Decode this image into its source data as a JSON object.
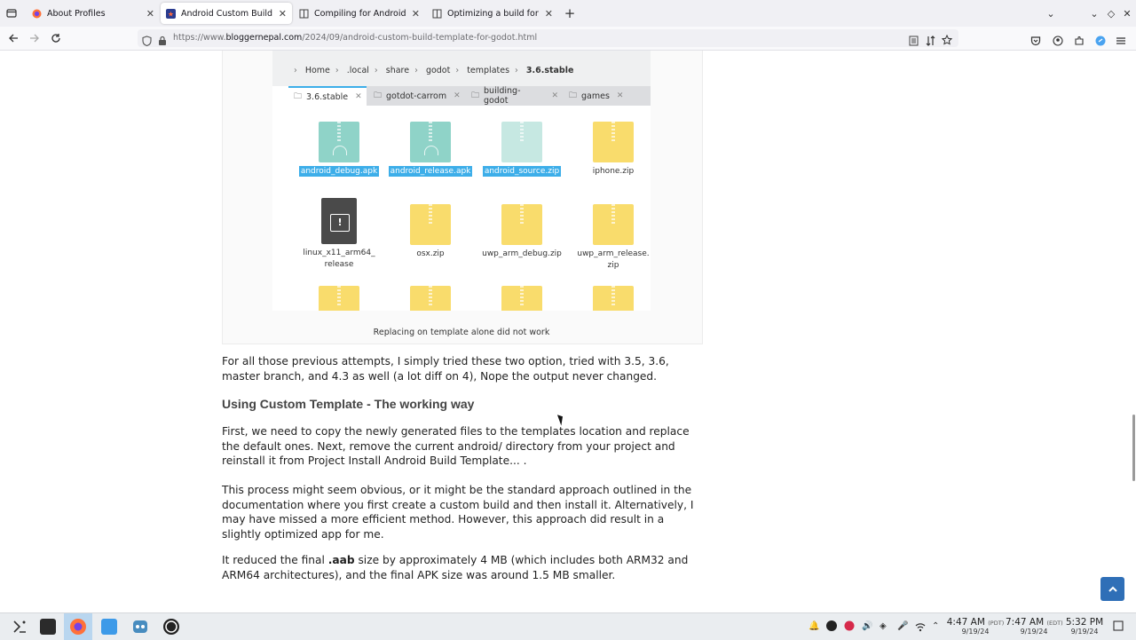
{
  "browser": {
    "tabs": [
      {
        "title": "About Profiles",
        "active": false
      },
      {
        "title": "Android Custom Build Templ",
        "active": true
      },
      {
        "title": "Compiling for Android — G",
        "active": false
      },
      {
        "title": "Optimizing a build for size",
        "active": false
      }
    ],
    "new_tab_label": "+",
    "url_prefix": "https://www.",
    "url_domain": "bloggernepal.com",
    "url_path": "/2024/09/android-custom-build-template-for-godot.html"
  },
  "figure": {
    "breadcrumbs": [
      "Home",
      ".local",
      "share",
      "godot",
      "templates",
      "3.6.stable"
    ],
    "fm_tabs": [
      {
        "label": "3.6.stable",
        "active": true
      },
      {
        "label": "gotdot-carrom",
        "active": false
      },
      {
        "label": "building-godot",
        "active": false
      },
      {
        "label": "games",
        "active": false
      }
    ],
    "files": [
      {
        "name": "android_debug.apk",
        "kind": "apk",
        "selected": true
      },
      {
        "name": "android_release.apk",
        "kind": "apk",
        "selected": true
      },
      {
        "name": "android_source.zip",
        "kind": "apkl",
        "selected": true
      },
      {
        "name": "iphone.zip",
        "kind": "zip",
        "selected": false
      },
      {
        "name": "linux_x11_arm64_ release",
        "kind": "bin",
        "selected": false
      },
      {
        "name": "osx.zip",
        "kind": "zip",
        "selected": false
      },
      {
        "name": "uwp_arm_debug.zip",
        "kind": "zip",
        "selected": false
      },
      {
        "name": "uwp_arm_release. zip",
        "kind": "zip",
        "selected": false
      }
    ],
    "caption": "Replacing on template alone did not work"
  },
  "article": {
    "p1": " For all those previous attempts, I simply tried these two option, tried with 3.5, 3.6, master branch, and 4.3 as well (a lot diff on 4), Nope the output never changed.",
    "heading": "Using Custom Template - The working way",
    "p2": "First, we need to copy the newly generated files to the templates location and replace the default ones. Next, remove the current android/ directory from your project and reinstall it from Project Install Android Build Template... .",
    "p3": "This process might seem obvious, or it might be the standard approach outlined in the documentation where you first create a custom build and then install it. Alternatively, I may have missed a more efficient method. However, this approach did result in a slightly optimized app for me.",
    "p4_before": "It reduced the final ",
    "p4_bold": ".aab",
    "p4_after": " size by approximately 4 MB (which includes both ARM32 and ARM64 architectures), and the final APK size was around 1.5 MB smaller."
  },
  "taskbar": {
    "clocks": [
      {
        "time": "4:47 AM",
        "tz": "(PDT)",
        "date": "9/19/24"
      },
      {
        "time": "7:47 AM",
        "tz": "(EDT)",
        "date": "9/19/24"
      },
      {
        "time": "5:32 PM",
        "tz": "",
        "date": "9/19/24"
      }
    ]
  },
  "colors": {
    "selection": "#3daee9",
    "back_to_top": "#2f6fb7",
    "zip_folder": "#f9dc6c",
    "apk": "#8fd3c8"
  }
}
